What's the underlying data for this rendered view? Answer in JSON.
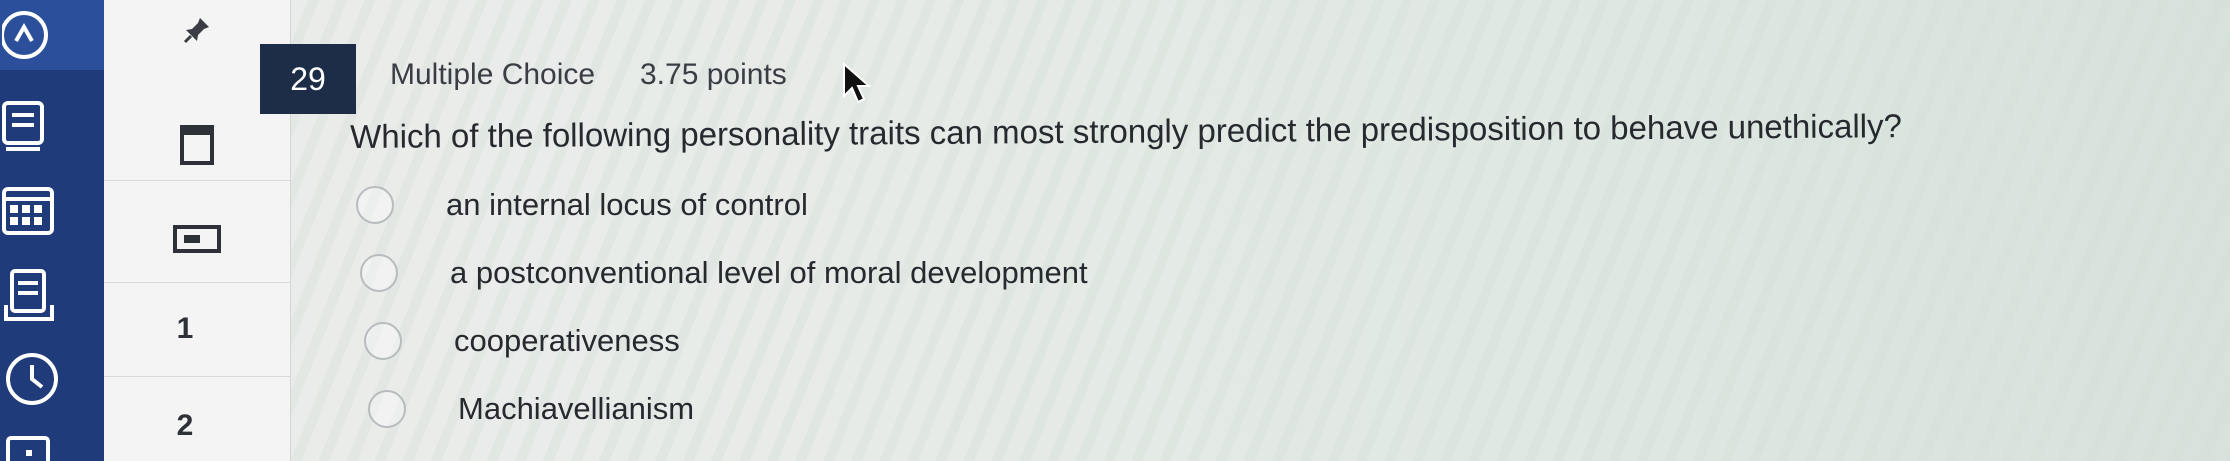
{
  "nav_rail": {
    "icons": [
      "dashboard-icon",
      "notebook-icon",
      "calendar-icon",
      "document-list-icon",
      "clock-icon",
      "media-icon"
    ]
  },
  "question_panel": {
    "pin_icon": "pin-icon",
    "items": [
      {
        "icon": "bookmark-icon"
      },
      {
        "icon": "flag-card-icon"
      },
      {
        "number": "1"
      },
      {
        "number": "2"
      }
    ]
  },
  "question": {
    "number": "29",
    "type": "Multiple Choice",
    "points": "3.75 points",
    "text": "Which of the following personality traits can most strongly predict the predisposition to behave unethically?",
    "options": [
      {
        "label": "an internal locus of control",
        "selected": false
      },
      {
        "label": "a postconventional level of moral development",
        "selected": false
      },
      {
        "label": "cooperativeness",
        "selected": false
      },
      {
        "label": "Machiavellianism",
        "selected": false
      }
    ]
  },
  "colors": {
    "rail": "#1f3b7a",
    "question_badge": "#1d2d48",
    "text": "#26292e"
  }
}
